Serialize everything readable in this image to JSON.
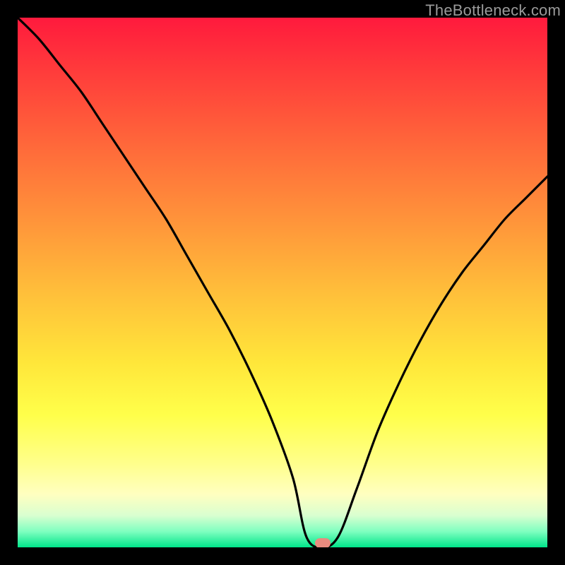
{
  "watermark": "TheBottleneck.com",
  "marker": {
    "color": "#e98b7f",
    "x_fraction": 0.576,
    "y_fraction": 0.992
  },
  "chart_data": {
    "type": "line",
    "title": "",
    "xlabel": "",
    "ylabel": "",
    "xlim": [
      0,
      1
    ],
    "ylim": [
      0,
      100
    ],
    "grid": false,
    "legend": false,
    "note": "Axes are not labeled in the image; x is normalized 0–1 left→right, y is bottleneck percentage 0–100 where 100 = top (red) and 0 = bottom (green). Values estimated from curve against the color gradient.",
    "series": [
      {
        "name": "bottleneck-curve",
        "x": [
          0.0,
          0.04,
          0.08,
          0.12,
          0.16,
          0.2,
          0.24,
          0.28,
          0.32,
          0.36,
          0.4,
          0.44,
          0.48,
          0.52,
          0.545,
          0.575,
          0.605,
          0.64,
          0.68,
          0.72,
          0.76,
          0.8,
          0.84,
          0.88,
          0.92,
          0.96,
          1.0
        ],
        "y": [
          100,
          96,
          91,
          86,
          80,
          74,
          68,
          62,
          55,
          48,
          41,
          33,
          24,
          13,
          2,
          0,
          2,
          11,
          22,
          31,
          39,
          46,
          52,
          57,
          62,
          66,
          70
        ]
      }
    ],
    "optimum": {
      "x_fraction": 0.576,
      "bottleneck_percent": 0
    },
    "background_gradient_stops": [
      {
        "pos": 0.0,
        "color": "#ff1a3d"
      },
      {
        "pos": 0.25,
        "color": "#ff6b3a"
      },
      {
        "pos": 0.52,
        "color": "#ffbf3a"
      },
      {
        "pos": 0.75,
        "color": "#ffff4a"
      },
      {
        "pos": 0.94,
        "color": "#d9ffd0"
      },
      {
        "pos": 1.0,
        "color": "#00e58a"
      }
    ]
  }
}
